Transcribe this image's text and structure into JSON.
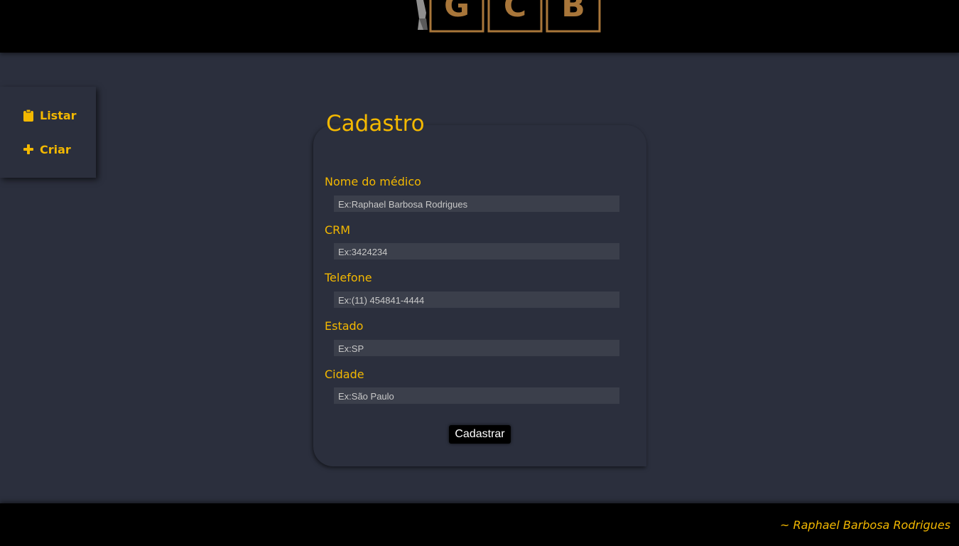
{
  "header": {
    "logo_letters": [
      "G",
      "C",
      "B"
    ]
  },
  "sidebar": {
    "items": [
      {
        "label": "Listar",
        "icon": "clipboard-icon"
      },
      {
        "label": "Criar",
        "icon": "plus-icon"
      }
    ]
  },
  "form": {
    "title": "Cadastro",
    "fields": [
      {
        "label": "Nome do médico",
        "placeholder": "Ex:Raphael Barbosa Rodrigues"
      },
      {
        "label": "CRM",
        "placeholder": "Ex:3424234"
      },
      {
        "label": "Telefone",
        "placeholder": "Ex:(11) 454841-4444"
      },
      {
        "label": "Estado",
        "placeholder": "Ex:SP"
      },
      {
        "label": "Cidade",
        "placeholder": "Ex:São Paulo"
      }
    ],
    "submit_label": "Cadastrar"
  },
  "footer": {
    "credit": "~ Raphael Barbosa Rodrigues"
  },
  "colors": {
    "accent": "#f3b800",
    "background": "#2b2f3d",
    "bar": "#000000",
    "input_bg": "#3b3f4b",
    "logo_gold": "#a8763a"
  }
}
